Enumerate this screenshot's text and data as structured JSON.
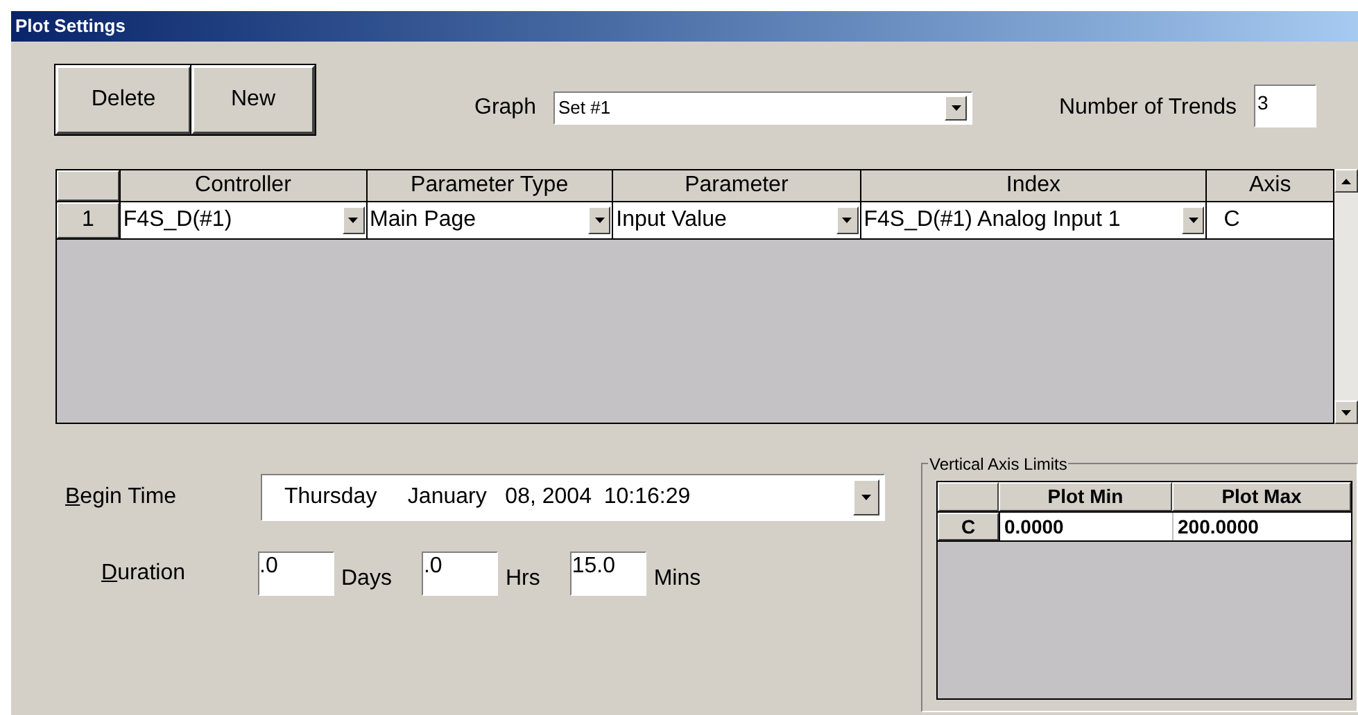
{
  "window": {
    "title": "Plot Settings"
  },
  "buttons": [
    {
      "label": "Delete"
    },
    {
      "label": "New"
    }
  ],
  "graph": {
    "label": "Graph",
    "value": "Set #1"
  },
  "trends": {
    "label": "Number of Trends",
    "value": "3"
  },
  "table": {
    "columns": [
      "Controller",
      "Parameter Type",
      "Parameter",
      "Index",
      "Axis"
    ],
    "rows": [
      {
        "number": "1",
        "cells": [
          {
            "kind": "dropdown",
            "value": "F4S_D(#1)"
          },
          {
            "kind": "dropdown",
            "value": "Main Page"
          },
          {
            "kind": "dropdown",
            "value": "Input Value"
          },
          {
            "kind": "dropdown",
            "value": "F4S_D(#1) Analog Input 1"
          },
          {
            "kind": "text",
            "value": "C"
          }
        ]
      }
    ]
  },
  "begin_time": {
    "label": "Begin Time",
    "day": "Thursday",
    "date": "January   08, 2004  10:16:29"
  },
  "duration": {
    "label": "Duration",
    "fields": [
      {
        "value": ".0",
        "unit": "Days"
      },
      {
        "value": ".0",
        "unit": "Hrs"
      },
      {
        "value": "15.0",
        "unit": "Mins"
      }
    ]
  },
  "axis_limits": {
    "title": "Vertical Axis Limits",
    "columns": [
      "Plot Min",
      "Plot Max"
    ],
    "rows": [
      {
        "axis": "C",
        "min": "0.0000",
        "max": "200.0000"
      }
    ]
  }
}
